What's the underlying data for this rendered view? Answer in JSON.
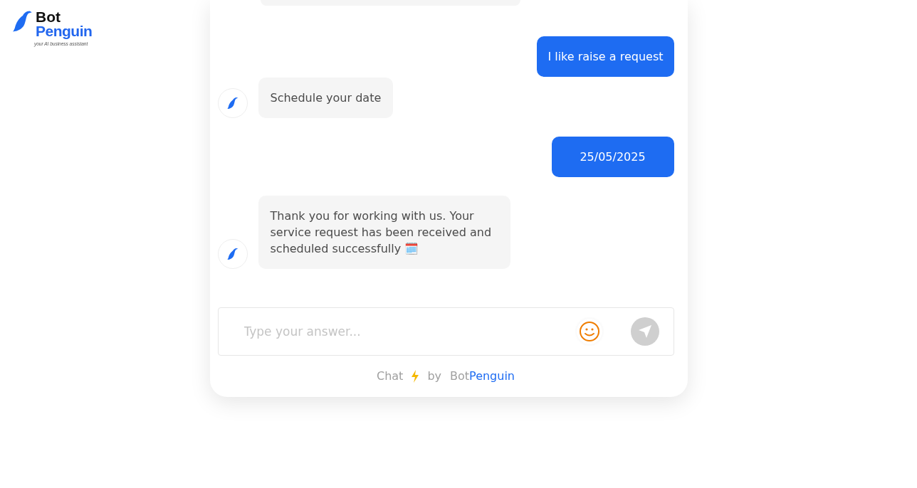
{
  "logo": {
    "line1": "Bot",
    "line2": "Penguin",
    "tagline": "your AI business assistant"
  },
  "messages": [
    {
      "kind": "partial"
    },
    {
      "kind": "user",
      "text": "I like raise a request"
    },
    {
      "kind": "bot",
      "text": "Schedule your date"
    },
    {
      "kind": "user",
      "text": "25/05/2025"
    },
    {
      "kind": "bot",
      "text": "Thank you for working with us. Your service request has been received and scheduled successfully 🗓️"
    }
  ],
  "composer": {
    "placeholder": "Type your answer..."
  },
  "footer": {
    "chat": "Chat",
    "by": "by",
    "brand_1": "Bot",
    "brand_2": "Penguin"
  }
}
